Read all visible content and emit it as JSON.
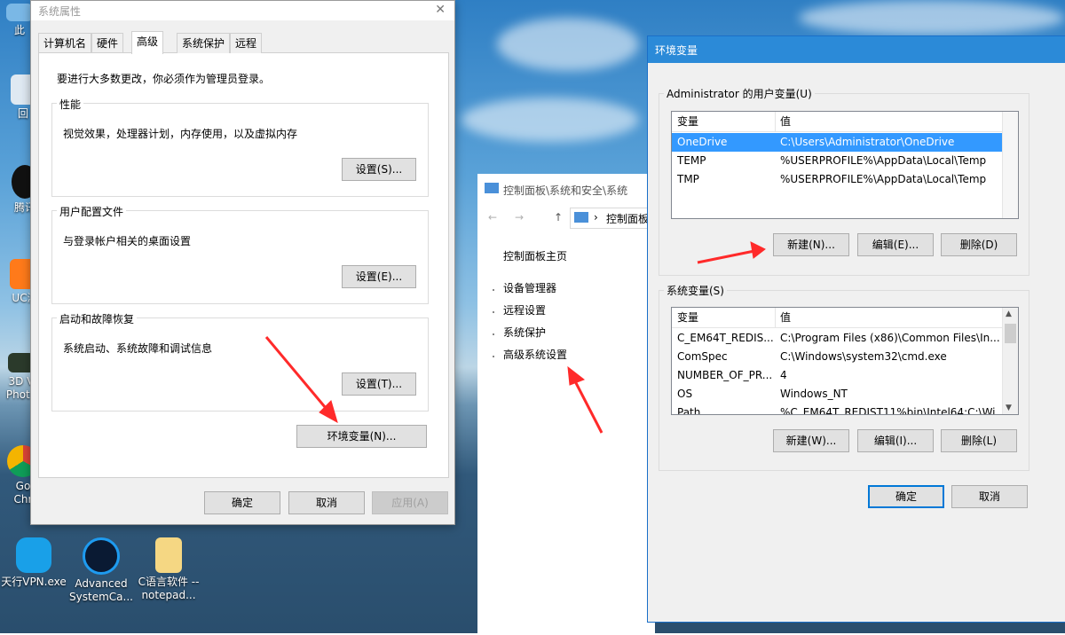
{
  "desktop": {
    "icons": [
      {
        "label": "此",
        "icon": "this-pc-icon"
      },
      {
        "label": "回",
        "icon": "recycle-bin-icon"
      },
      {
        "label": "腾讯",
        "icon": "qq-penguin-icon"
      },
      {
        "label": "UC浏",
        "icon": "uc-browser-icon"
      },
      {
        "label": "3D V",
        "icon": "3d-vision-icon"
      },
      {
        "label": "Photo",
        "icon": "photo-icon"
      },
      {
        "label": "Go",
        "icon": "chrome-icon"
      },
      {
        "label": "Chr",
        "icon": "chrome-icon"
      },
      {
        "label": "天行VPN.exe",
        "icon": "vpn-icon"
      },
      {
        "label": "Advanced SystemCa...",
        "icon": "advanced-systemcare-icon"
      },
      {
        "label": "C语言软件 --notepad...",
        "icon": "folder-icon"
      }
    ]
  },
  "sysprops": {
    "title": "系统属性",
    "close": "✕",
    "tabs": [
      "计算机名",
      "硬件",
      "高级",
      "系统保护",
      "远程"
    ],
    "active_tab": "高级",
    "admin_note": "要进行大多数更改，你必须作为管理员登录。",
    "performance": {
      "title": "性能",
      "desc": "视觉效果，处理器计划，内存使用，以及虚拟内存",
      "button": "设置(S)..."
    },
    "profiles": {
      "title": "用户配置文件",
      "desc": "与登录帐户相关的桌面设置",
      "button": "设置(E)..."
    },
    "startup": {
      "title": "启动和故障恢复",
      "desc": "系统启动、系统故障和调试信息",
      "button": "设置(T)..."
    },
    "env_button": "环境变量(N)...",
    "ok": "确定",
    "cancel": "取消",
    "apply": "应用(A)"
  },
  "control_panel": {
    "title": "控制面板\\系统和安全\\系统",
    "address": "控制面板",
    "home": "控制面板主页",
    "links": [
      "设备管理器",
      "远程设置",
      "系统保护",
      "高级系统设置"
    ]
  },
  "env": {
    "title": "环境变量",
    "user_group": "Administrator 的用户变量(U)",
    "col_var": "变量",
    "col_val": "值",
    "user_vars": [
      {
        "name": "OneDrive",
        "value": "C:\\Users\\Administrator\\OneDrive",
        "selected": true
      },
      {
        "name": "TEMP",
        "value": "%USERPROFILE%\\AppData\\Local\\Temp",
        "selected": false
      },
      {
        "name": "TMP",
        "value": "%USERPROFILE%\\AppData\\Local\\Temp",
        "selected": false
      }
    ],
    "user_new": "新建(N)...",
    "user_edit": "编辑(E)...",
    "user_delete": "删除(D)",
    "sys_group": "系统变量(S)",
    "sys_vars": [
      {
        "name": "C_EM64T_REDIS...",
        "value": "C:\\Program Files (x86)\\Common Files\\In..."
      },
      {
        "name": "ComSpec",
        "value": "C:\\Windows\\system32\\cmd.exe"
      },
      {
        "name": "NUMBER_OF_PR...",
        "value": "4"
      },
      {
        "name": "OS",
        "value": "Windows_NT"
      },
      {
        "name": "Path",
        "value": "%C_EM64T_REDIST11%bin\\Intel64;C:\\Wi..."
      }
    ],
    "sys_new": "新建(W)...",
    "sys_edit": "编辑(I)...",
    "sys_delete": "删除(L)",
    "ok": "确定",
    "cancel": "取消"
  },
  "colors": {
    "accent": "#0078d7",
    "selection": "#3399ff",
    "annotation_arrow": "#ff2a2a"
  }
}
